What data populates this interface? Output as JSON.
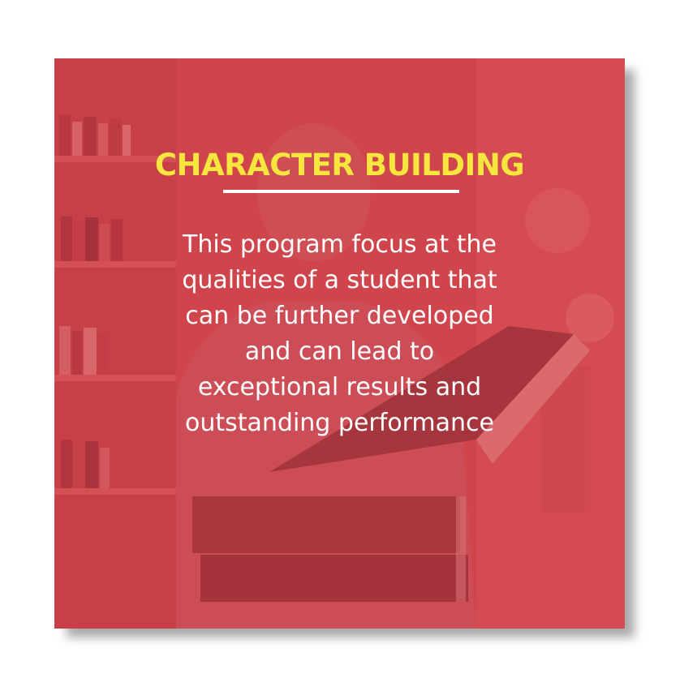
{
  "card": {
    "title": "CHARACTER BUILDING",
    "description": "This program focus at the\nqualities of a student that\ncan be further developed\nand can lead to\nexceptional results and\noutstanding performance"
  },
  "colors": {
    "overlay": "#d63a42",
    "title": "#f7e63d",
    "text": "#ffffff",
    "rule": "#ffffff"
  }
}
